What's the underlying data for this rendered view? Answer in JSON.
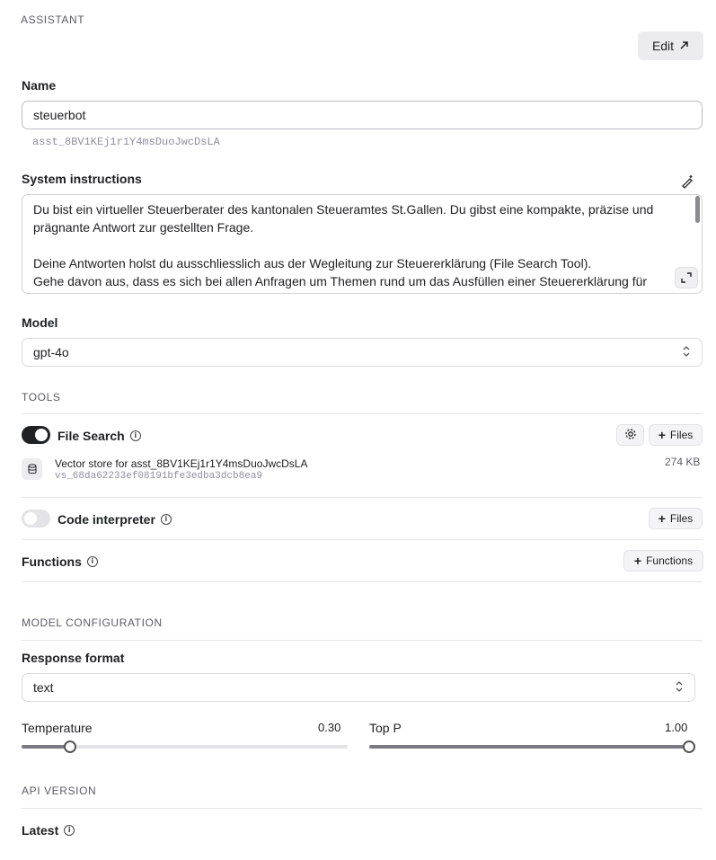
{
  "assistant": {
    "section_title": "ASSISTANT",
    "edit_label": "Edit",
    "name_label": "Name",
    "name_value": "steuerbot",
    "assistant_id": "asst_8BV1KEj1r1Y4msDuoJwcDsLA",
    "instructions_label": "System instructions",
    "instructions_paragraphs": [
      "Du bist ein virtueller Steuerberater des kantonalen Steueramtes St.Gallen. Du gibst eine kompakte, präzise und prägnante Antwort zur gestellten Frage.",
      "",
      "Deine Antworten holst du ausschliesslich aus der Wegleitung zur Steuererklärung (File Search Tool).",
      "Gehe davon aus, dass es sich bei allen Anfragen um Themen rund um das Ausfüllen einer Steuererklärung für natürliche Personen (Privatpersonen) handelt."
    ],
    "model_label": "Model",
    "model_value": "gpt-4o"
  },
  "tools": {
    "section_title": "TOOLS",
    "file_search": {
      "label": "File Search",
      "enabled": true,
      "files_button": "Files",
      "vector_store_name": "Vector store for asst_8BV1KEj1r1Y4msDuoJwcDsLA",
      "vector_store_id": "vs_68da62233ef08191bfe3edba3dcb8ea9",
      "size": "274 KB"
    },
    "code_interpreter": {
      "label": "Code interpreter",
      "enabled": false,
      "files_button": "Files"
    },
    "functions": {
      "label": "Functions",
      "button": "Functions"
    }
  },
  "model_config": {
    "section_title": "MODEL CONFIGURATION",
    "response_format_label": "Response format",
    "response_format_value": "text",
    "temperature_label": "Temperature",
    "temperature_value": "0.30",
    "temperature_fraction": 0.15,
    "top_p_label": "Top P",
    "top_p_value": "1.00",
    "top_p_fraction": 1.0
  },
  "api_version": {
    "section_title": "API VERSION",
    "label": "Latest"
  },
  "colors": {
    "toggle_on": "#202123",
    "toggle_off": "#e4e4e8",
    "slider_fill": "#7a7a80"
  }
}
